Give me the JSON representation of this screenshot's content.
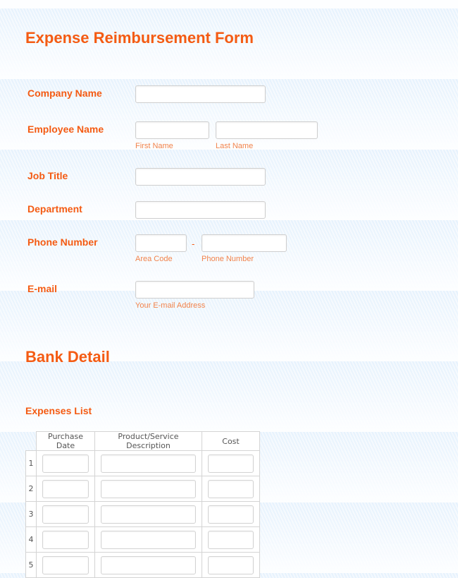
{
  "form": {
    "title": "Expense Reimbursement Form",
    "colors": {
      "accent": "#f45b13",
      "sublabel": "#f2834b",
      "border": "#cfcfcf"
    },
    "fields": {
      "company_name": {
        "label": "Company Name",
        "value": ""
      },
      "employee_name": {
        "label": "Employee Name",
        "first": {
          "value": "",
          "sublabel": "First Name"
        },
        "last": {
          "value": "",
          "sublabel": "Last Name"
        }
      },
      "job_title": {
        "label": "Job Title",
        "value": ""
      },
      "department": {
        "label": "Department",
        "value": ""
      },
      "phone_number": {
        "label": "Phone Number",
        "separator": "-",
        "area": {
          "value": "",
          "sublabel": "Area Code"
        },
        "number": {
          "value": "",
          "sublabel": "Phone Number"
        }
      },
      "email": {
        "label": "E-mail",
        "value": "",
        "sublabel": "Your E-mail Address"
      }
    },
    "bank_section": {
      "title": "Bank Detail"
    },
    "expenses": {
      "title": "Expenses List",
      "columns": [
        "Purchase Date",
        "Product/Service Description",
        "Cost"
      ],
      "rows": [
        {
          "num": "1",
          "date": "",
          "desc": "",
          "cost": ""
        },
        {
          "num": "2",
          "date": "",
          "desc": "",
          "cost": ""
        },
        {
          "num": "3",
          "date": "",
          "desc": "",
          "cost": ""
        },
        {
          "num": "4",
          "date": "",
          "desc": "",
          "cost": ""
        },
        {
          "num": "5",
          "date": "",
          "desc": "",
          "cost": ""
        }
      ]
    }
  }
}
